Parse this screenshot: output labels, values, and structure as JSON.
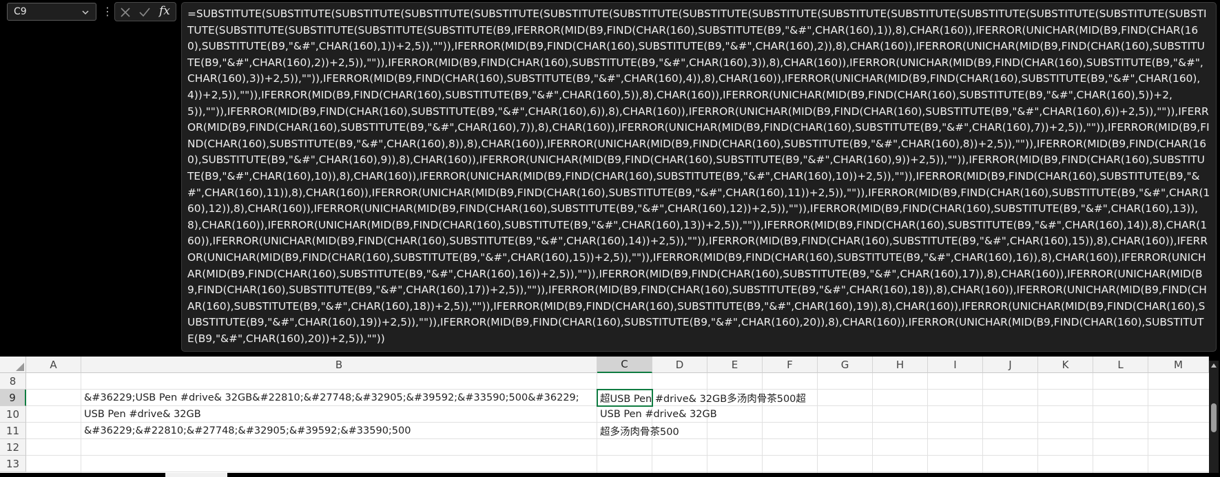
{
  "name_box": {
    "value": "C9"
  },
  "formula_bar": {
    "formula": "=SUBSTITUTE(SUBSTITUTE(SUBSTITUTE(SUBSTITUTE(SUBSTITUTE(SUBSTITUTE(SUBSTITUTE(SUBSTITUTE(SUBSTITUTE(SUBSTITUTE(SUBSTITUTE(SUBSTITUTE(SUBSTITUTE(SUBSTITUTE(SUBSTITUTE(SUBSTITUTE(SUBSTITUTE(SUBSTITUTE(SUBSTITUTE(B9,IFERROR(MID(B9,FIND(CHAR(160),SUBSTITUTE(B9,\"&#\",CHAR(160),1)),8),CHAR(160)),IFERROR(UNICHAR(MID(B9,FIND(CHAR(160),SUBSTITUTE(B9,\"&#\",CHAR(160),1))+2,5)),\"\")),IFERROR(MID(B9,FIND(CHAR(160),SUBSTITUTE(B9,\"&#\",CHAR(160),2)),8),CHAR(160)),IFERROR(UNICHAR(MID(B9,FIND(CHAR(160),SUBSTITUTE(B9,\"&#\",CHAR(160),2))+2,5)),\"\")),IFERROR(MID(B9,FIND(CHAR(160),SUBSTITUTE(B9,\"&#\",CHAR(160),3)),8),CHAR(160)),IFERROR(UNICHAR(MID(B9,FIND(CHAR(160),SUBSTITUTE(B9,\"&#\",CHAR(160),3))+2,5)),\"\")),IFERROR(MID(B9,FIND(CHAR(160),SUBSTITUTE(B9,\"&#\",CHAR(160),4)),8),CHAR(160)),IFERROR(UNICHAR(MID(B9,FIND(CHAR(160),SUBSTITUTE(B9,\"&#\",CHAR(160),4))+2,5)),\"\")),IFERROR(MID(B9,FIND(CHAR(160),SUBSTITUTE(B9,\"&#\",CHAR(160),5)),8),CHAR(160)),IFERROR(UNICHAR(MID(B9,FIND(CHAR(160),SUBSTITUTE(B9,\"&#\",CHAR(160),5))+2,5)),\"\")),IFERROR(MID(B9,FIND(CHAR(160),SUBSTITUTE(B9,\"&#\",CHAR(160),6)),8),CHAR(160)),IFERROR(UNICHAR(MID(B9,FIND(CHAR(160),SUBSTITUTE(B9,\"&#\",CHAR(160),6))+2,5)),\"\")),IFERROR(MID(B9,FIND(CHAR(160),SUBSTITUTE(B9,\"&#\",CHAR(160),7)),8),CHAR(160)),IFERROR(UNICHAR(MID(B9,FIND(CHAR(160),SUBSTITUTE(B9,\"&#\",CHAR(160),7))+2,5)),\"\")),IFERROR(MID(B9,FIND(CHAR(160),SUBSTITUTE(B9,\"&#\",CHAR(160),8)),8),CHAR(160)),IFERROR(UNICHAR(MID(B9,FIND(CHAR(160),SUBSTITUTE(B9,\"&#\",CHAR(160),8))+2,5)),\"\")),IFERROR(MID(B9,FIND(CHAR(160),SUBSTITUTE(B9,\"&#\",CHAR(160),9)),8),CHAR(160)),IFERROR(UNICHAR(MID(B9,FIND(CHAR(160),SUBSTITUTE(B9,\"&#\",CHAR(160),9))+2,5)),\"\")),IFERROR(MID(B9,FIND(CHAR(160),SUBSTITUTE(B9,\"&#\",CHAR(160),10)),8),CHAR(160)),IFERROR(UNICHAR(MID(B9,FIND(CHAR(160),SUBSTITUTE(B9,\"&#\",CHAR(160),10))+2,5)),\"\")),IFERROR(MID(B9,FIND(CHAR(160),SUBSTITUTE(B9,\"&#\",CHAR(160),11)),8),CHAR(160)),IFERROR(UNICHAR(MID(B9,FIND(CHAR(160),SUBSTITUTE(B9,\"&#\",CHAR(160),11))+2,5)),\"\")),IFERROR(MID(B9,FIND(CHAR(160),SUBSTITUTE(B9,\"&#\",CHAR(160),12)),8),CHAR(160)),IFERROR(UNICHAR(MID(B9,FIND(CHAR(160),SUBSTITUTE(B9,\"&#\",CHAR(160),12))+2,5)),\"\")),IFERROR(MID(B9,FIND(CHAR(160),SUBSTITUTE(B9,\"&#\",CHAR(160),13)),8),CHAR(160)),IFERROR(UNICHAR(MID(B9,FIND(CHAR(160),SUBSTITUTE(B9,\"&#\",CHAR(160),13))+2,5)),\"\")),IFERROR(MID(B9,FIND(CHAR(160),SUBSTITUTE(B9,\"&#\",CHAR(160),14)),8),CHAR(160)),IFERROR(UNICHAR(MID(B9,FIND(CHAR(160),SUBSTITUTE(B9,\"&#\",CHAR(160),14))+2,5)),\"\")),IFERROR(MID(B9,FIND(CHAR(160),SUBSTITUTE(B9,\"&#\",CHAR(160),15)),8),CHAR(160)),IFERROR(UNICHAR(MID(B9,FIND(CHAR(160),SUBSTITUTE(B9,\"&#\",CHAR(160),15))+2,5)),\"\")),IFERROR(MID(B9,FIND(CHAR(160),SUBSTITUTE(B9,\"&#\",CHAR(160),16)),8),CHAR(160)),IFERROR(UNICHAR(MID(B9,FIND(CHAR(160),SUBSTITUTE(B9,\"&#\",CHAR(160),16))+2,5)),\"\")),IFERROR(MID(B9,FIND(CHAR(160),SUBSTITUTE(B9,\"&#\",CHAR(160),17)),8),CHAR(160)),IFERROR(UNICHAR(MID(B9,FIND(CHAR(160),SUBSTITUTE(B9,\"&#\",CHAR(160),17))+2,5)),\"\")),IFERROR(MID(B9,FIND(CHAR(160),SUBSTITUTE(B9,\"&#\",CHAR(160),18)),8),CHAR(160)),IFERROR(UNICHAR(MID(B9,FIND(CHAR(160),SUBSTITUTE(B9,\"&#\",CHAR(160),18))+2,5)),\"\")),IFERROR(MID(B9,FIND(CHAR(160),SUBSTITUTE(B9,\"&#\",CHAR(160),19)),8),CHAR(160)),IFERROR(UNICHAR(MID(B9,FIND(CHAR(160),SUBSTITUTE(B9,\"&#\",CHAR(160),19))+2,5)),\"\")),IFERROR(MID(B9,FIND(CHAR(160),SUBSTITUTE(B9,\"&#\",CHAR(160),20)),8),CHAR(160)),IFERROR(UNICHAR(MID(B9,FIND(CHAR(160),SUBSTITUTE(B9,\"&#\",CHAR(160),20))+2,5)),\"\"))"
  },
  "fx_label": "fx",
  "columns": [
    "A",
    "B",
    "C",
    "D",
    "E",
    "F",
    "G",
    "H",
    "I",
    "J",
    "K",
    "L",
    "M"
  ],
  "selected_column": "C",
  "rows": [
    "8",
    "9",
    "10",
    "11",
    "12",
    "13"
  ],
  "selected_row": "9",
  "cells": {
    "B9": "&#36229;USB Pen #drive& 32GB&#22810;&#27748;&#32905;&#39592;&#33590;500&#36229;",
    "B10": "USB Pen #drive& 32GB",
    "B11": "&#36229;&#22810;&#27748;&#32905;&#39592;&#33590;500",
    "C9": "超USB Pen #drive& 32GB多汤肉骨茶500超",
    "C10": "USB Pen #drive& 32GB",
    "C11": "超多汤肉骨茶500"
  },
  "colors": {
    "accent_green": "#107c41",
    "dark_bg": "#1f1f1f"
  }
}
